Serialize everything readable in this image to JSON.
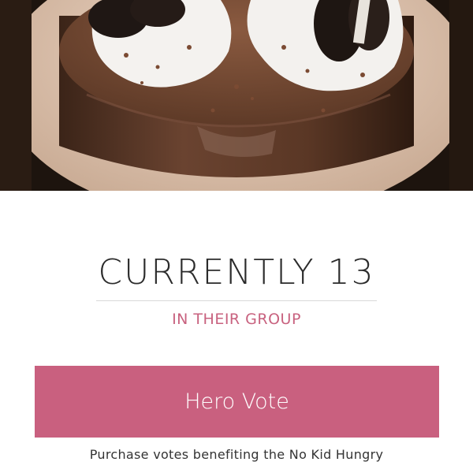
{
  "entry": {
    "photo_alt": "Chocolate cake with whipped cream and Oreo cookies"
  },
  "ranking": {
    "title": "CURRENTLY 13",
    "subtitle": "IN THEIR GROUP"
  },
  "vote": {
    "button_label": "Hero Vote",
    "note": "Purchase votes benefiting the No Kid Hungry"
  },
  "colors": {
    "accent": "#c9607f",
    "title_text": "#2b2b2b"
  }
}
